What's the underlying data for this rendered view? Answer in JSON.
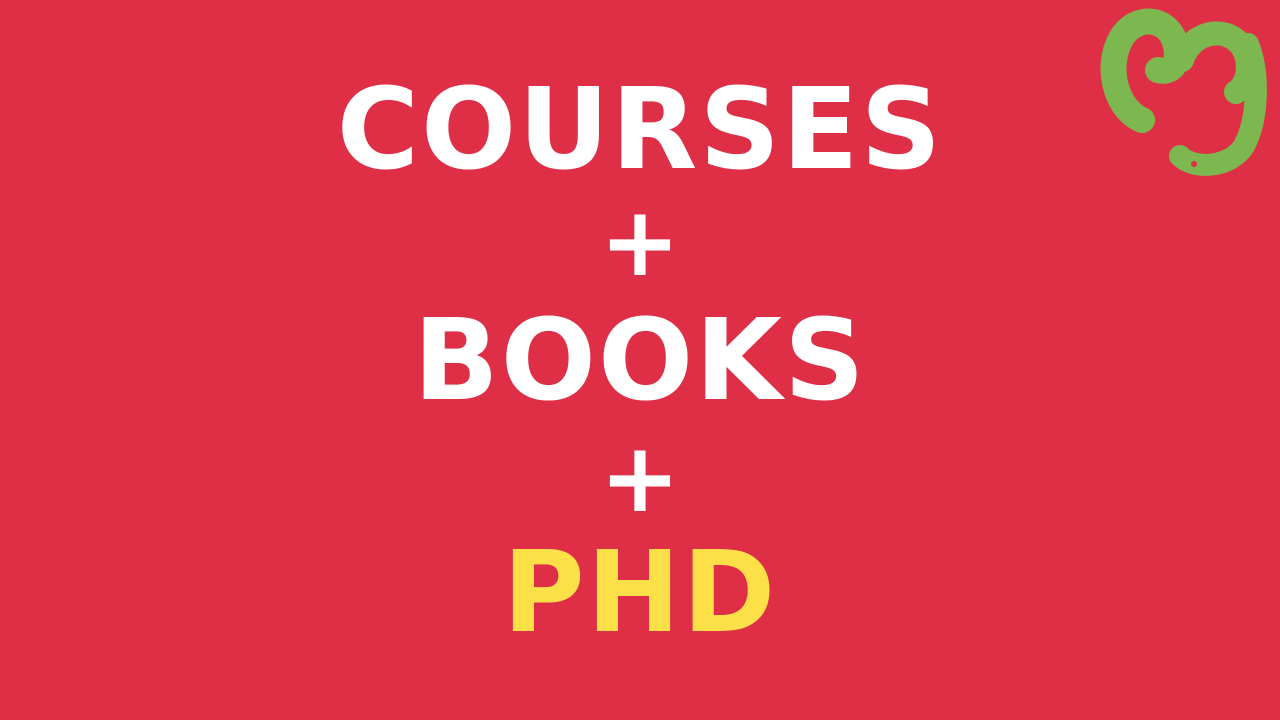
{
  "slide": {
    "lines": [
      {
        "text": "COURSES",
        "kind": "word"
      },
      {
        "text": "+",
        "kind": "plus"
      },
      {
        "text": "BOOKS",
        "kind": "word"
      },
      {
        "text": "+",
        "kind": "plus"
      },
      {
        "text": "PHD",
        "kind": "highlight"
      }
    ]
  },
  "logo": {
    "icon": "m-swirl-logo-icon",
    "color": "#7cb84f"
  },
  "colors": {
    "background": "#df2f46",
    "text": "#ffffff",
    "highlight": "#fde047"
  }
}
